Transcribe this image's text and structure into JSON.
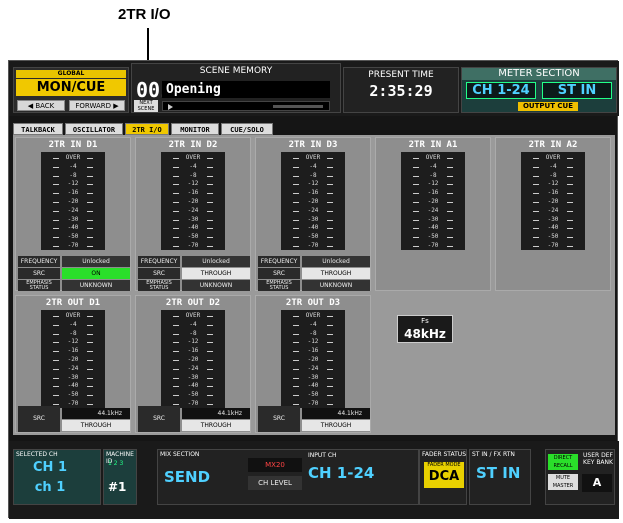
{
  "callout": "2TR I/O",
  "header": {
    "global_label": "GLOBAL",
    "mon_cue": "MON/CUE",
    "back": "◀ BACK",
    "forward": "FORWARD ▶",
    "scene_title": "SCENE MEMORY",
    "scene_num": "001",
    "scene_name": "Opening",
    "next_scene": "NEXT SCENE",
    "present_time_title": "PRESENT TIME",
    "present_time": "2:35:29",
    "meter_title": "METER SECTION",
    "meter_ch": "CH 1-24",
    "meter_st": "ST IN",
    "output_cue": "OUTPUT CUE"
  },
  "tabs": [
    "TALKBACK",
    "OSCILLATOR",
    "2TR I/O",
    "MONITOR",
    "CUE/SOLO"
  ],
  "meter_labels": [
    "OVER",
    "-4",
    "-8",
    "-12",
    "-16",
    "-20",
    "-24",
    "-30",
    "-40",
    "-50",
    "-70"
  ],
  "inputs": [
    {
      "name": "2TR IN D1",
      "freq": "Unlocked",
      "src": "ON",
      "emph": "UNKNOWN"
    },
    {
      "name": "2TR IN D2",
      "freq": "Unlocked",
      "src": "THROUGH",
      "emph": "UNKNOWN"
    },
    {
      "name": "2TR IN D3",
      "freq": "Unlocked",
      "src": "THROUGH",
      "emph": "UNKNOWN"
    },
    {
      "name": "2TR IN A1"
    },
    {
      "name": "2TR IN A2"
    }
  ],
  "outputs": [
    {
      "name": "2TR OUT D1",
      "freq": "44.1kHz",
      "src": "THROUGH"
    },
    {
      "name": "2TR OUT D2",
      "freq": "44.1kHz",
      "src": "THROUGH"
    },
    {
      "name": "2TR OUT D3",
      "freq": "44.1kHz",
      "src": "THROUGH"
    }
  ],
  "labels": {
    "frequency": "FREQUENCY",
    "src": "SRC",
    "emph1": "EMPHASIS",
    "emph2": "STATUS"
  },
  "fs": {
    "label": "Fs",
    "value": "48kHz"
  },
  "footer": {
    "selected_ch_label": "SELECTED CH",
    "selected_ch": "CH 1",
    "selected_name": "ch 1",
    "machine_id_label": "MACHINE ID",
    "machine_ids": "1  2  3",
    "machine_id": "#1",
    "mix_section": "MIX SECTION",
    "send": "SEND",
    "mix_name": "MX20",
    "ch_level": "CH LEVEL",
    "input_ch_label": "INPUT CH",
    "input_ch": "CH 1-24",
    "fader_status": "FADER STATUS",
    "fader_mode": "FADER MODE",
    "dca": "DCA",
    "stin_label": "ST IN / FX RTN",
    "stin": "ST IN",
    "direct_recall": "DIRECT RECALL",
    "mute_master": "MUTE MASTER",
    "user_def": "USER DEF KEY BANK",
    "bank": "A"
  }
}
